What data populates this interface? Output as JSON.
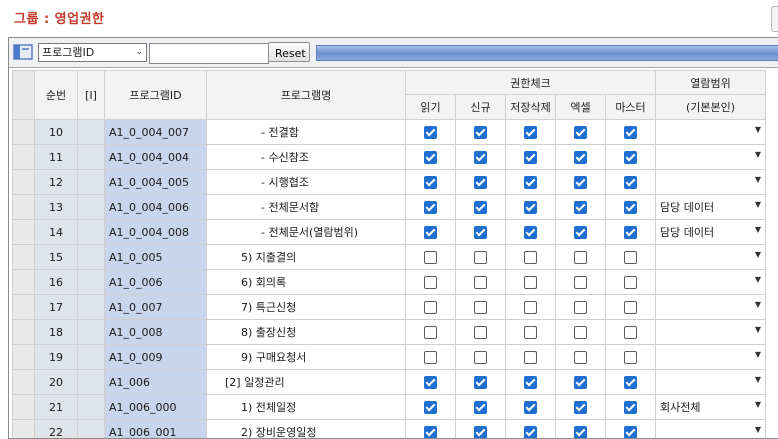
{
  "page": {
    "title": "그룹 : 영업권한"
  },
  "toolbar": {
    "program_select": "프로그램ID",
    "search_value": "",
    "reset_label": "Reset"
  },
  "header": {
    "seq": "순번",
    "flag": "[I]",
    "program_id": "프로그램ID",
    "program_name": "프로그램명",
    "perm_group": "권한체크",
    "read": "읽기",
    "new": "신규",
    "save_delete": "저장삭제",
    "excel": "엑셀",
    "master": "마스터",
    "range_group": "열람범위",
    "range_default": "(기본본인)"
  },
  "rows": [
    {
      "seq": "10",
      "id": "A1_0_004_007",
      "name": "- 전결함",
      "indent": 48,
      "read": true,
      "new": true,
      "sd": true,
      "excel": true,
      "master": true,
      "range": ""
    },
    {
      "seq": "11",
      "id": "A1_0_004_004",
      "name": "- 수신참조",
      "indent": 48,
      "read": true,
      "new": true,
      "sd": true,
      "excel": true,
      "master": true,
      "range": ""
    },
    {
      "seq": "12",
      "id": "A1_0_004_005",
      "name": "- 시행협조",
      "indent": 48,
      "read": true,
      "new": true,
      "sd": true,
      "excel": true,
      "master": true,
      "range": ""
    },
    {
      "seq": "13",
      "id": "A1_0_004_006",
      "name": "- 전체문서함",
      "indent": 48,
      "read": true,
      "new": true,
      "sd": true,
      "excel": true,
      "master": true,
      "range": "담당 데이터"
    },
    {
      "seq": "14",
      "id": "A1_0_004_008",
      "name": "- 전체문서(열람범위)",
      "indent": 48,
      "read": true,
      "new": true,
      "sd": true,
      "excel": true,
      "master": true,
      "range": "담당 데이터"
    },
    {
      "seq": "15",
      "id": "A1_0_005",
      "name": "5) 지출결의",
      "indent": 28,
      "read": false,
      "new": false,
      "sd": false,
      "excel": false,
      "master": false,
      "range": ""
    },
    {
      "seq": "16",
      "id": "A1_0_006",
      "name": "6) 회의록",
      "indent": 28,
      "read": false,
      "new": false,
      "sd": false,
      "excel": false,
      "master": false,
      "range": ""
    },
    {
      "seq": "17",
      "id": "A1_0_007",
      "name": "7) 특근신청",
      "indent": 28,
      "read": false,
      "new": false,
      "sd": false,
      "excel": false,
      "master": false,
      "range": ""
    },
    {
      "seq": "18",
      "id": "A1_0_008",
      "name": "8) 출장신청",
      "indent": 28,
      "read": false,
      "new": false,
      "sd": false,
      "excel": false,
      "master": false,
      "range": ""
    },
    {
      "seq": "19",
      "id": "A1_0_009",
      "name": "9) 구매요청서",
      "indent": 28,
      "read": false,
      "new": false,
      "sd": false,
      "excel": false,
      "master": false,
      "range": ""
    },
    {
      "seq": "20",
      "id": "A1_006",
      "name": "[2] 일정관리",
      "indent": 12,
      "read": true,
      "new": true,
      "sd": true,
      "excel": true,
      "master": true,
      "range": ""
    },
    {
      "seq": "21",
      "id": "A1_006_000",
      "name": "1) 전체일정",
      "indent": 28,
      "read": true,
      "new": true,
      "sd": true,
      "excel": true,
      "master": true,
      "range": "회사전체"
    },
    {
      "seq": "22",
      "id": "A1_006_001",
      "name": "2) 장비운영일정",
      "indent": 28,
      "read": true,
      "new": true,
      "sd": true,
      "excel": true,
      "master": true,
      "range": ""
    }
  ]
}
